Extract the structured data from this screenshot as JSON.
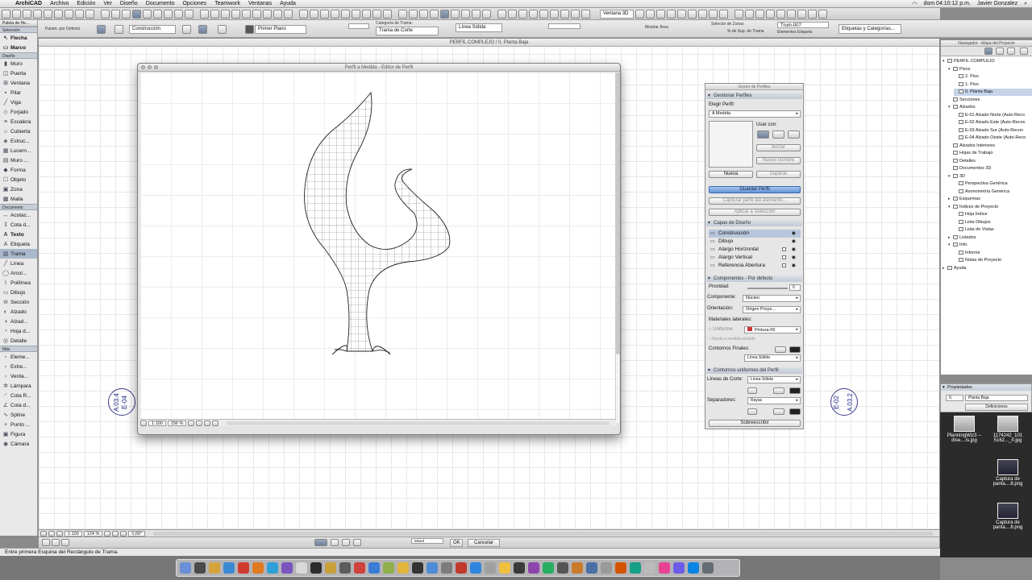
{
  "menubar": {
    "app": "ArchiCAD",
    "items": [
      "Archivo",
      "Edición",
      "Ver",
      "Diseño",
      "Documento",
      "Opciones",
      "Teamwork",
      "Ventanas",
      "Ayuda"
    ],
    "clock": "dom 04:10:12 p.m.",
    "user": "Javier Gonzalez"
  },
  "infobox": {
    "pen_label": "Param. por Defecto",
    "layer_value": "Construcción",
    "floor_value": "Primer Plano",
    "fill_label": "Categoría de Trama:",
    "fill_value": "Trama de Corte",
    "line_value": "Línea Sólida",
    "view3d": "Ventana 3D",
    "show_area": "Mostrar Área",
    "zone_label": "Selector de Zonas",
    "trama_pct": "% de Sup. de Trama",
    "elem_label": "Elementos Etiqueta",
    "trum_value": "Trum-007",
    "etiquetas_btn": "Etiquetas y Categorías..."
  },
  "toolbox": {
    "title": "Paleta de He...",
    "sections": [
      {
        "name": "Selección",
        "tools": [
          {
            "icon": "arrow-icon",
            "glyph": "↖",
            "label": "Flecha",
            "bold": true
          },
          {
            "icon": "marquee-icon",
            "glyph": "▭",
            "label": "Marco",
            "bold": true
          }
        ]
      },
      {
        "name": "Diseño",
        "tools": [
          {
            "icon": "wall-icon",
            "glyph": "▮",
            "label": "Muro"
          },
          {
            "icon": "door-icon",
            "glyph": "◫",
            "label": "Puerta"
          },
          {
            "icon": "window-icon",
            "glyph": "⊞",
            "label": "Ventana"
          },
          {
            "icon": "column-icon",
            "glyph": "▪",
            "label": "Pilar"
          },
          {
            "icon": "beam-icon",
            "glyph": "╱",
            "label": "Viga"
          },
          {
            "icon": "slab-icon",
            "glyph": "◇",
            "label": "Forjado"
          },
          {
            "icon": "stair-icon",
            "glyph": "≡",
            "label": "Escalera"
          },
          {
            "icon": "roof-icon",
            "glyph": "⌂",
            "label": "Cubierta"
          },
          {
            "icon": "structure-icon",
            "glyph": "◈",
            "label": "Estruc..."
          },
          {
            "icon": "curtain-icon",
            "glyph": "▦",
            "label": "Lucern..."
          },
          {
            "icon": "curtainwall-icon",
            "glyph": "▤",
            "label": "Muro ..."
          },
          {
            "icon": "morph-icon",
            "glyph": "◆",
            "label": "Forma"
          },
          {
            "icon": "object-icon",
            "glyph": "☐",
            "label": "Objeto"
          },
          {
            "icon": "zone-icon",
            "glyph": "▣",
            "label": "Zona"
          },
          {
            "icon": "mesh-icon",
            "glyph": "▩",
            "label": "Malla"
          }
        ]
      },
      {
        "name": "Documento",
        "tools": [
          {
            "icon": "dimension-icon",
            "glyph": "↔",
            "label": "Acotac..."
          },
          {
            "icon": "level-icon",
            "glyph": "↧",
            "label": "Cota d..."
          },
          {
            "icon": "text-icon",
            "glyph": "A",
            "label": "Texto",
            "bold": true
          },
          {
            "icon": "label-icon",
            "glyph": "A",
            "label": "Etiqueta"
          },
          {
            "icon": "fill-icon",
            "glyph": "▧",
            "label": "Trama",
            "active": true
          },
          {
            "icon": "line-icon",
            "glyph": "╱",
            "label": "Línea"
          },
          {
            "icon": "arc-icon",
            "glyph": "◯",
            "label": "Arco/..."
          },
          {
            "icon": "polyline-icon",
            "glyph": "⌇",
            "label": "Polilínea"
          },
          {
            "icon": "drawing-icon",
            "glyph": "▭",
            "label": "Dibujo"
          },
          {
            "icon": "section-icon",
            "glyph": "⊖",
            "label": "Sección"
          },
          {
            "icon": "elevation-icon",
            "glyph": "◐",
            "label": "Alzado"
          },
          {
            "icon": "ielevation-icon",
            "glyph": "◑",
            "label": "Alzad..."
          },
          {
            "icon": "worksheet-icon",
            "glyph": "◔",
            "label": "Hoja d..."
          },
          {
            "icon": "detail-icon",
            "glyph": "◎",
            "label": "Detalle"
          }
        ]
      },
      {
        "name": "Más",
        "tools": [
          {
            "icon": "element-icon",
            "glyph": "▫",
            "label": "Eleme..."
          },
          {
            "icon": "extrude-icon",
            "glyph": "▫",
            "label": "Extre..."
          },
          {
            "icon": "win2-icon",
            "glyph": "▫",
            "label": "Venta..."
          },
          {
            "icon": "lamp-icon",
            "glyph": "✲",
            "label": "Lámpara"
          },
          {
            "icon": "radial-icon",
            "glyph": "◜",
            "label": "Cota R..."
          },
          {
            "icon": "angle-icon",
            "glyph": "∠",
            "label": "Cota d..."
          },
          {
            "icon": "spline-icon",
            "glyph": "∿",
            "label": "Spline"
          },
          {
            "icon": "hotspot-icon",
            "glyph": "+",
            "label": "Punto ..."
          },
          {
            "icon": "figure-icon",
            "glyph": "▣",
            "label": "Figura"
          },
          {
            "icon": "camera-icon",
            "glyph": "◉",
            "label": "Cámara"
          }
        ]
      }
    ]
  },
  "canvas": {
    "title": "PERFIL COMPLEJO / 0. Planta Baja",
    "markers": [
      {
        "a": "A 03.4",
        "b": "E-04"
      },
      {
        "a": "A 03.2",
        "b": "E-02"
      }
    ]
  },
  "editor": {
    "title": "Perfil a Medida - Editor de Perfil",
    "scale": "1:100",
    "zoom": "156 %"
  },
  "panel": {
    "title": "Gestor de Perfiles",
    "sec_manage": "Gestionar Perfiles",
    "choose_label": "Elegir Perfil:",
    "choose_value": "A Medida",
    "use_label": "Usar con:",
    "delete_btn": "Borrar",
    "rename_btn": "Nuevo nombre",
    "new_btn": "Nueva",
    "duplicate_btn": "Duplicar",
    "save_btn": "Guardar Perfil",
    "capture_btn": "Capturar perfil del elemento...",
    "apply_btn": "Aplicar a Selección",
    "sec_layers": "Capas de Diseño",
    "layers": [
      {
        "name": "Construcción",
        "sel": true,
        "check": false
      },
      {
        "name": "Dibujo",
        "sel": false,
        "check": false
      },
      {
        "name": "Alargo Horizontal",
        "sel": false,
        "check": true
      },
      {
        "name": "Alargo Vertical",
        "sel": false,
        "check": true
      },
      {
        "name": "Referencia Abertura",
        "sel": false,
        "check": true
      }
    ],
    "sec_components": "Componentes - Por defecto",
    "priority_label": "Prioridad:",
    "priority_value": "0",
    "component_label": "Componente:",
    "component_value": "Núcleo",
    "orientation_label": "Orientación:",
    "orientation_value": "Origen Proye...",
    "materials_label": "Materiales laterales:",
    "uniform_label": "Uniforme",
    "material_value": "Pintura-06",
    "edge_label": "Borde a medida incluido",
    "endlines_label": "Contornos Finales:",
    "endline_value": "Línea Sólida",
    "sec_uniform": "Contornos uniformes del Perfil",
    "cut_lines_label": "Líneas de Corte:",
    "cut_line_value": "Línea Sólida",
    "separators_label": "Separadores:",
    "separator_value": "Rayas",
    "override_btn": "Sobreescribir",
    "accent": "#5f93d6"
  },
  "navigator": {
    "title": "Navegador - Mapa del Proyecto",
    "rows": [
      {
        "label": "PERFIL COMPLEJO",
        "level": 0,
        "arrow": "▾"
      },
      {
        "label": "Pisos",
        "level": 1,
        "arrow": "▾"
      },
      {
        "label": "2. Piso",
        "level": 2,
        "arrow": ""
      },
      {
        "label": "1. Piso",
        "level": 2,
        "arrow": ""
      },
      {
        "label": "0. Planta Baja",
        "level": 2,
        "arrow": "",
        "sel": true
      },
      {
        "label": "Secciones",
        "level": 1,
        "arrow": ""
      },
      {
        "label": "Alzados",
        "level": 1,
        "arrow": "▾"
      },
      {
        "label": "E-01 Alzado Norte (Auto-Reco",
        "level": 2,
        "arrow": ""
      },
      {
        "label": "E-02 Alzado Este (Auto-Recon",
        "level": 2,
        "arrow": ""
      },
      {
        "label": "E-03 Alzado Sur (Auto-Recon",
        "level": 2,
        "arrow": ""
      },
      {
        "label": "E-04 Alzado Oeste (Auto-Reco",
        "level": 2,
        "arrow": ""
      },
      {
        "label": "Alzados Interiores",
        "level": 1,
        "arrow": ""
      },
      {
        "label": "Hojas de Trabajo",
        "level": 1,
        "arrow": ""
      },
      {
        "label": "Detalles",
        "level": 1,
        "arrow": ""
      },
      {
        "label": "Documentos 3D",
        "level": 1,
        "arrow": ""
      },
      {
        "label": "3D",
        "level": 1,
        "arrow": "▾"
      },
      {
        "label": "Perspectiva Genérica",
        "level": 2,
        "arrow": ""
      },
      {
        "label": "Axonometría Genérica",
        "level": 2,
        "arrow": ""
      },
      {
        "label": "Esquemas",
        "level": 1,
        "arrow": "▸"
      },
      {
        "label": "Índices de Proyecto",
        "level": 1,
        "arrow": "▾"
      },
      {
        "label": "Hoja Índice",
        "level": 2,
        "arrow": ""
      },
      {
        "label": "Lista Dibujos",
        "level": 2,
        "arrow": ""
      },
      {
        "label": "Lista de Vistas",
        "level": 2,
        "arrow": ""
      },
      {
        "label": "Listados",
        "level": 1,
        "arrow": "▸"
      },
      {
        "label": "Info.",
        "level": 1,
        "arrow": "▾"
      },
      {
        "label": "Informe",
        "level": 2,
        "arrow": ""
      },
      {
        "label": "Notas de Proyecto",
        "level": 2,
        "arrow": ""
      },
      {
        "label": "Ayuda",
        "level": 0,
        "arrow": "▸"
      }
    ]
  },
  "properties": {
    "title": "Propiedades",
    "id": "0.",
    "name": "Planta Baja",
    "defs_btn": "Definiciones"
  },
  "desktop": {
    "icons": [
      {
        "label": "PlanningWiz3 --dise....is.jpg",
        "dark": false
      },
      {
        "label": "1174242_101 5162..._n.jpg",
        "dark": false
      },
      {
        "label": "Captura de panta....8.png",
        "dark": true
      },
      {
        "label": "Captura de panta....8.png",
        "dark": true
      }
    ]
  },
  "bottombar": {
    "scale": "1:100",
    "zoom": "124 %",
    "angle": "0,00°"
  },
  "infobar": {
    "ok_btn": "OK",
    "cancel_btn": "Cancelar",
    "mixed_label": "Mixed"
  },
  "status": "Entre primera Esquina del Rectángulo de Trama."
}
